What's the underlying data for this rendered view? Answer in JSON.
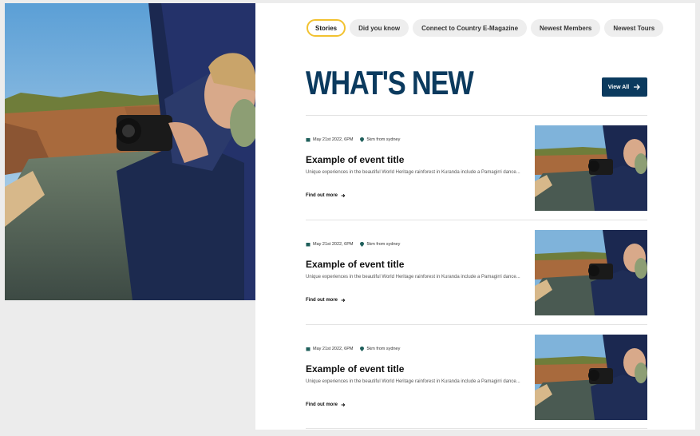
{
  "tabs": [
    {
      "label": "Stories",
      "active": true
    },
    {
      "label": "Did you know",
      "active": false
    },
    {
      "label": "Connect to Country E-Magazine",
      "active": false
    },
    {
      "label": "Newest Members",
      "active": false
    },
    {
      "label": "Newest Tours",
      "active": false
    }
  ],
  "section": {
    "title": "WHAT'S NEW",
    "view_all_label": "View All"
  },
  "events": [
    {
      "date": "May 21st 2022, 6PM",
      "location": "5km from sydney",
      "title": "Example of event title",
      "description": "Unique experiences in the beautiful World Heritage rainforest in Kuranda include a Pamagirri dance...",
      "link_label": "Find out more"
    },
    {
      "date": "May 21st 2022, 6PM",
      "location": "5km from sydney",
      "title": "Example of event title",
      "description": "Unique experiences in the beautiful World Heritage rainforest in Kuranda include a Pamagirri dance...",
      "link_label": "Find out more"
    },
    {
      "date": "May 21st 2022, 6PM",
      "location": "5km from sydney",
      "title": "Example of event title",
      "description": "Unique experiences in the beautiful World Heritage rainforest in Kuranda include a Pamagirri dance...",
      "link_label": "Find out more"
    }
  ],
  "colors": {
    "brand_navy": "#0b3a5e",
    "tab_active_border": "#f2c230",
    "meta_icon": "#1f5f5b"
  },
  "icons": {
    "calendar": "calendar-icon",
    "location": "location-pin-icon",
    "arrow": "arrow-right-icon"
  }
}
